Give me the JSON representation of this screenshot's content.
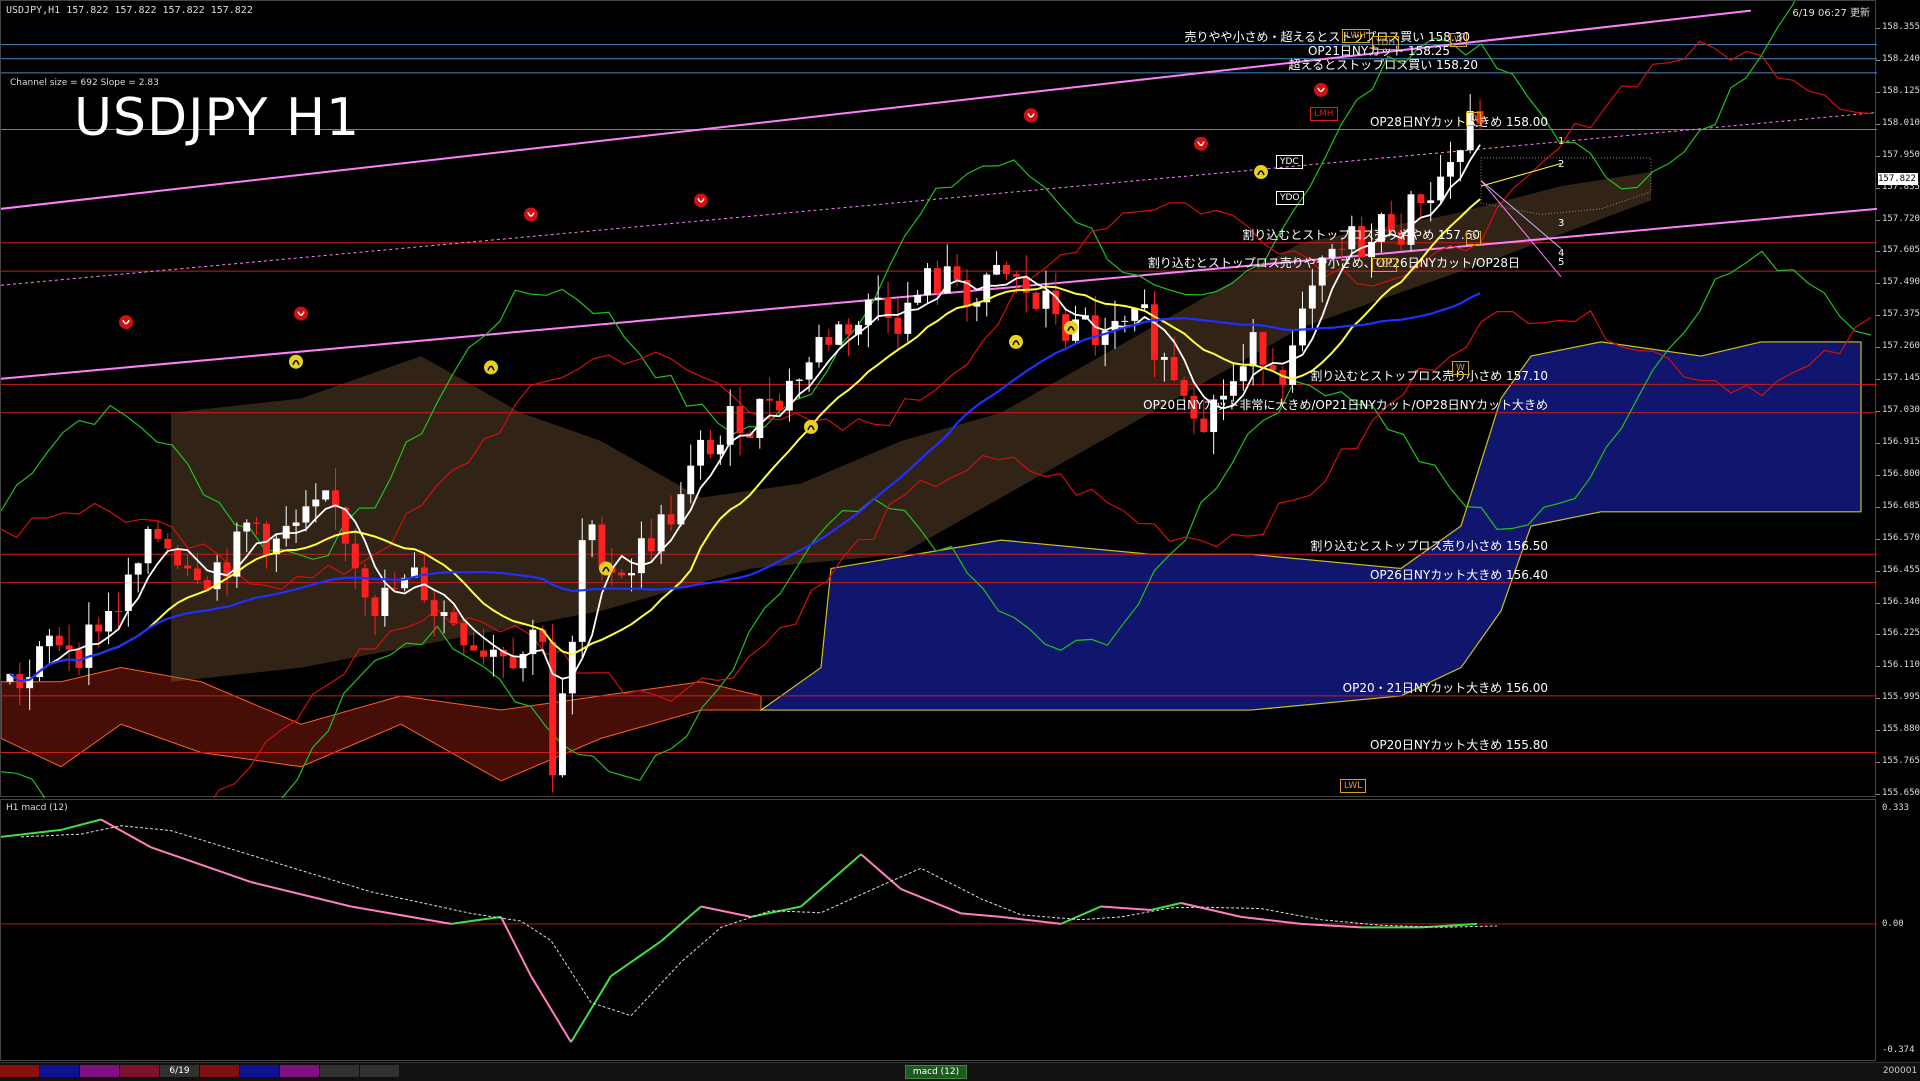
{
  "header": {
    "info": "USDJPY,H1  157.822 157.822 157.822 157.822",
    "timestamp": "6/19 06:27 更新",
    "channel_info": "Channel size = 692 Slope = 2.83",
    "title": "USDJPY H1"
  },
  "levels": [
    {
      "text": "売りやや小さめ・超えるとストップロス買い 158.30",
      "price": 158.3,
      "color": "#4a8ac8"
    },
    {
      "text": "OP21日NYカット 158.25",
      "price": 158.25,
      "color": "#4a8ac8"
    },
    {
      "text": "超えるとストップロス買い 158.20",
      "price": 158.2,
      "color": "#4a8ac8"
    },
    {
      "text": "OP28日NYカット大きめ 158.00",
      "price": 158.0,
      "color": "#4a8ac8"
    },
    {
      "text": "割り込むとストップロス売りややめ 157.60",
      "price": 157.6,
      "color": "#c81e1e"
    },
    {
      "text": "割り込むとストップロス売りやや小さめ、OP26日NYカット/OP28日",
      "price": 157.5,
      "color": "#c81e1e"
    },
    {
      "text": "割り込むとストップロス売り小さめ 157.10",
      "price": 157.1,
      "color": "#c81e1e"
    },
    {
      "text": "OP20日NYカット非常に大きめ/OP21日NYカット/OP28日NYカット大きめ",
      "price": 157.0,
      "color": "#c81e1e"
    },
    {
      "text": "割り込むとストップロス売り小さめ 156.50",
      "price": 156.5,
      "color": "#c81e1e"
    },
    {
      "text": "OP26日NYカット大きめ 156.40",
      "price": 156.4,
      "color": "#c81e1e"
    },
    {
      "text": "OP20・21日NYカット大きめ 156.00",
      "price": 156.0,
      "color": "#c81e1e"
    },
    {
      "text": "OP20日NYカット大きめ 155.80",
      "price": 155.8,
      "color": "#c81e1e"
    }
  ],
  "price_axis": [
    "158.355",
    "158.240",
    "158.125",
    "158.010",
    "157.950",
    "157.835",
    "157.720",
    "157.605",
    "157.490",
    "157.375",
    "157.260",
    "157.145",
    "157.030",
    "156.915",
    "156.800",
    "156.685",
    "156.570",
    "156.455",
    "156.340",
    "156.225",
    "156.110",
    "155.995",
    "155.880",
    "155.765",
    "155.650"
  ],
  "current_price": "157.822",
  "markers": [
    {
      "text": "LWH",
      "color": "#d4a020"
    },
    {
      "text": "YDH",
      "color": "#d4a020"
    },
    {
      "text": "W",
      "color": "#d4a020"
    },
    {
      "text": "LMH",
      "color": "#d02020"
    },
    {
      "text": "YDC",
      "color": "#ffffff"
    },
    {
      "text": "YDO",
      "color": "#ffffff"
    },
    {
      "text": "D",
      "color": "#d4a020"
    },
    {
      "text": "D",
      "color": "#d4a020"
    },
    {
      "text": "YDL",
      "color": "#d4a020"
    },
    {
      "text": "W",
      "color": "#d4a020"
    },
    {
      "text": "LWL",
      "color": "#d4a020"
    }
  ],
  "right_numbers": [
    "1",
    "2",
    "3",
    "4",
    "5"
  ],
  "macd": {
    "label": "H1  macd (12)",
    "axis": [
      "0.333",
      "0.00",
      "-0.374"
    ]
  },
  "bottom_bar": {
    "tabs": [
      "",
      "",
      "",
      "",
      "6/19",
      "",
      "",
      "",
      "",
      ""
    ],
    "center_tab": "macd (12)",
    "right_value": "200001"
  },
  "colors": {
    "bull": "#ffffff",
    "bear": "#ff2020",
    "ma_fast": "#ffffff",
    "ma_mid": "#ffff40",
    "ma_slow": "#2030ff",
    "channel": "#ff80ff",
    "macd_pos": "#40e040",
    "macd_neg": "#ff80c0"
  }
}
